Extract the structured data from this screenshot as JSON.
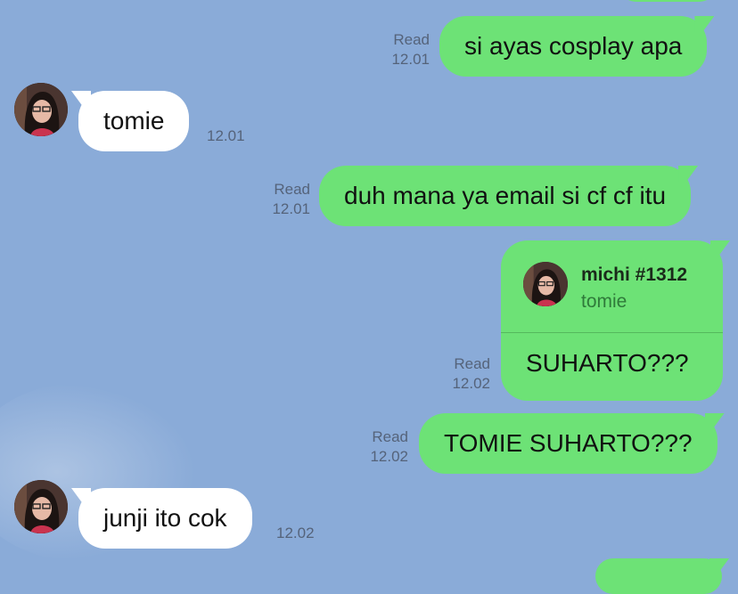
{
  "messages": [
    {
      "id": "m1",
      "text": "si ayas cosplay apa",
      "read": "Read",
      "time": "12.01"
    },
    {
      "id": "m2",
      "text": "tomie",
      "time": "12.01"
    },
    {
      "id": "m3",
      "text": "duh mana ya email si cf cf itu",
      "read": "Read",
      "time": "12.01"
    },
    {
      "id": "m4",
      "reply_to_name": "michi #1312",
      "reply_to_text": "tomie",
      "text": "SUHARTO???",
      "read": "Read",
      "time": "12.02"
    },
    {
      "id": "m5",
      "text": "TOMIE SUHARTO???",
      "read": "Read",
      "time": "12.02"
    },
    {
      "id": "m6",
      "text": "junji ito cok",
      "time": "12.02"
    }
  ],
  "colors": {
    "background": "#8aabd8",
    "outgoing_bubble": "#6de276",
    "incoming_bubble": "#ffffff",
    "meta_text": "#55637a"
  },
  "icons": {
    "avatar": "contact-profile-photo"
  }
}
